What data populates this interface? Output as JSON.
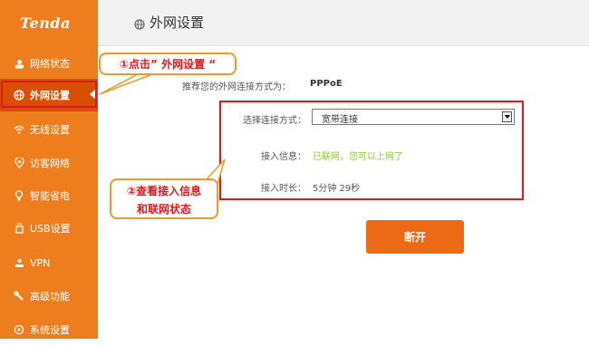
{
  "brand": {
    "logo_text": "Tenda"
  },
  "sidebar": {
    "items": [
      {
        "label": "网络状态",
        "icon": "network-status-icon"
      },
      {
        "label": "外网设置",
        "icon": "globe-icon",
        "active": true
      },
      {
        "label": "无线设置",
        "icon": "wifi-icon"
      },
      {
        "label": "访客网络",
        "icon": "guest-network-icon"
      },
      {
        "label": "智能省电",
        "icon": "power-save-icon"
      },
      {
        "label": "USB设置",
        "icon": "usb-icon"
      },
      {
        "label": "VPN",
        "icon": "vpn-icon"
      },
      {
        "label": "高级功能",
        "icon": "wrench-icon"
      },
      {
        "label": "系统设置",
        "icon": "system-settings-icon"
      }
    ]
  },
  "header": {
    "title": "外网设置",
    "icon": "globe-icon"
  },
  "main": {
    "recommend_label": "推荐您的外网连接方式为：",
    "recommend_value": "PPPoE",
    "connection_type_label": "选择连接方式：",
    "connection_type_value": "宽带连接",
    "access_info_label": "接入信息：",
    "access_info_value": "已联网，您可以上网了",
    "access_duration_label": "接入时长：",
    "access_duration_value": "5分钟 29秒",
    "disconnect_button": "断开"
  },
  "annotations": {
    "callout1": "①点击” 外网设置 “",
    "callout2_line1": "②查看接入信息",
    "callout2_line2": "和联网状态"
  },
  "colors": {
    "sidebar": "#ee7d1e",
    "active_item": "#d94f00",
    "button": "#ec6a15",
    "highlight": "#e0161b",
    "connected_text": "#8cc63f"
  }
}
